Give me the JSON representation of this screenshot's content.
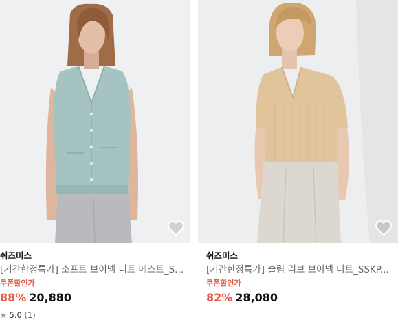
{
  "colors": {
    "accent": "#e35a4b",
    "photo_bg": "#eceeef"
  },
  "products": [
    {
      "brand": "쉬즈미스",
      "title": "[기간한정특가] 소프트 브이넥 니트 베스트_S...",
      "coupon_label": "쿠폰할인가",
      "discount": "88%",
      "price": "20,880",
      "rating": "5.0",
      "review_count": "(1)",
      "wishlist_icon": "heart-icon"
    },
    {
      "brand": "쉬즈미스",
      "title": "[기간한정특가] 슬림 리브 브이넥 니트_SSKP...",
      "coupon_label": "쿠폰할인가",
      "discount": "82%",
      "price": "28,080",
      "wishlist_icon": "heart-icon"
    }
  ]
}
